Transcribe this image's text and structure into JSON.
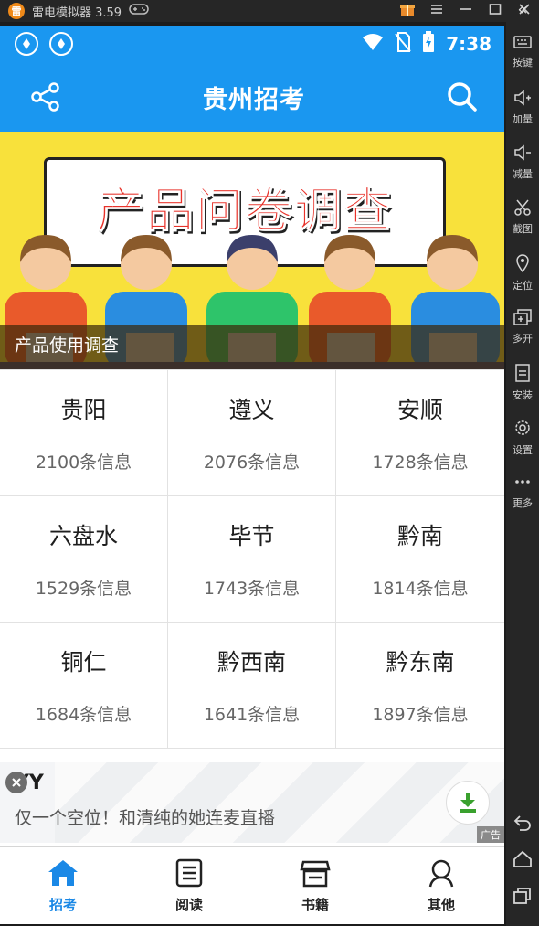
{
  "emulator": {
    "title": "雷电模拟器 3.59",
    "logo_glyph": "雷",
    "window_buttons": [
      "gift-icon",
      "menu-icon",
      "minimize-icon",
      "maximize-icon",
      "close-icon"
    ],
    "collapse_icon": "double-chevron-left-icon"
  },
  "status_bar": {
    "time": "7:38",
    "icons": [
      "app-notification-icon",
      "app-notification-icon",
      "wifi-icon",
      "no-sim-icon",
      "battery-charging-icon"
    ]
  },
  "app_bar": {
    "title": "贵州招考",
    "left_icon": "share-icon",
    "right_icon": "search-icon"
  },
  "banner": {
    "headline": "产品问卷调查",
    "caption": "产品使用调查",
    "colors": {
      "background": "#f8e13b",
      "headline": "#e8322a"
    }
  },
  "regions": [
    {
      "city": "贵阳",
      "count": "2100条信息"
    },
    {
      "city": "遵义",
      "count": "2076条信息"
    },
    {
      "city": "安顺",
      "count": "1728条信息"
    },
    {
      "city": "六盘水",
      "count": "1529条信息"
    },
    {
      "city": "毕节",
      "count": "1743条信息"
    },
    {
      "city": "黔南",
      "count": "1814条信息"
    },
    {
      "city": "铜仁",
      "count": "1684条信息"
    },
    {
      "city": "黔西南",
      "count": "1641条信息"
    },
    {
      "city": "黔东南",
      "count": "1897条信息"
    }
  ],
  "ad": {
    "brand": "YY",
    "text": "仅一个空位！和清纯的她连麦直播",
    "tag": "广告",
    "close_icon": "close-icon",
    "download_icon": "download-icon"
  },
  "bottom_nav": [
    {
      "label": "招考",
      "icon": "home-icon",
      "active": true
    },
    {
      "label": "阅读",
      "icon": "reader-icon",
      "active": false
    },
    {
      "label": "书籍",
      "icon": "bookstore-icon",
      "active": false
    },
    {
      "label": "其他",
      "icon": "person-icon",
      "active": false
    }
  ],
  "sidebar": {
    "items": [
      {
        "label": "按键",
        "icon": "keyboard-icon"
      },
      {
        "label": "加量",
        "icon": "volume-up-icon"
      },
      {
        "label": "减量",
        "icon": "volume-down-icon"
      },
      {
        "label": "截图",
        "icon": "scissors-icon"
      },
      {
        "label": "定位",
        "icon": "location-icon"
      },
      {
        "label": "多开",
        "icon": "multi-instance-icon"
      },
      {
        "label": "安装",
        "icon": "apk-install-icon"
      },
      {
        "label": "设置",
        "icon": "settings-icon"
      },
      {
        "label": "更多",
        "icon": "more-icon"
      }
    ],
    "system_buttons": [
      "back-icon",
      "home-icon",
      "recents-icon"
    ]
  },
  "colors": {
    "primary": "#1a97f0",
    "active_tab": "#1a88e6",
    "emulator_chrome": "#262626"
  }
}
